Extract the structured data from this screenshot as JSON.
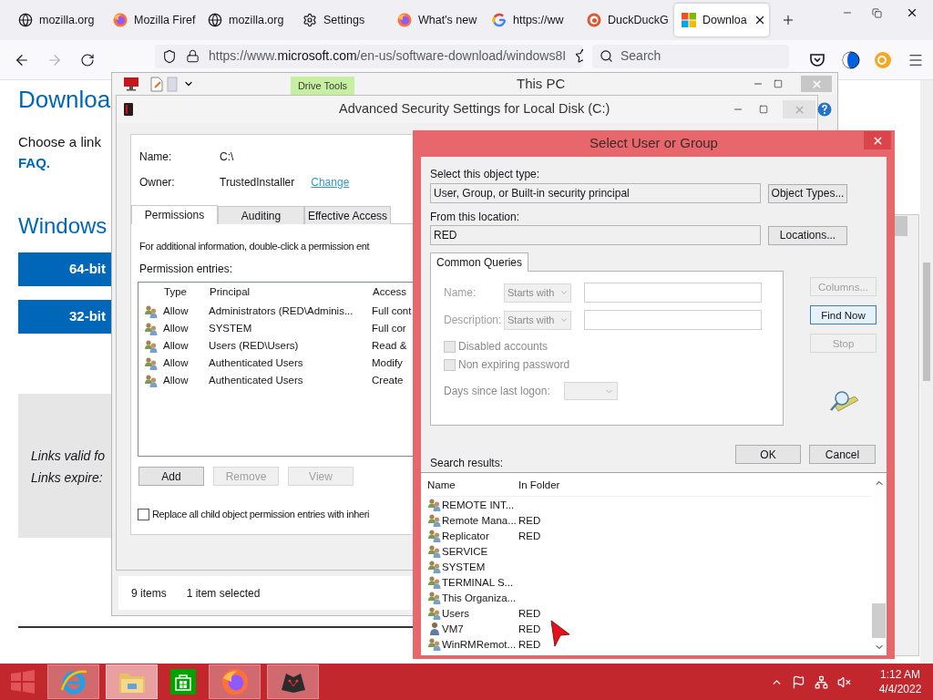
{
  "browser": {
    "tabs": [
      {
        "label": "mozilla.org",
        "kind": "globe",
        "selected": false
      },
      {
        "label": "Mozilla Firef",
        "kind": "firefox",
        "selected": false
      },
      {
        "label": "mozilla.org",
        "kind": "globe",
        "selected": false
      },
      {
        "label": "Settings",
        "kind": "gear",
        "selected": false
      },
      {
        "label": "What's new",
        "kind": "firefox",
        "selected": false
      },
      {
        "label": "https://ww",
        "kind": "google",
        "selected": false
      },
      {
        "label": "DuckDuckG",
        "kind": "duck",
        "selected": false
      },
      {
        "label": "Downloa",
        "kind": "windows",
        "selected": true
      }
    ],
    "url": {
      "prefix": "https://www.",
      "domain": "microsoft.com",
      "path": "/en-us/software-download/windows8I"
    },
    "search_placeholder": "Search",
    "page": {
      "heading": "Downloa",
      "intro": "Choose a link",
      "faq": "FAQ.",
      "subheading": "Windows",
      "downloads": [
        "64-bit",
        "32-bit"
      ],
      "notes": [
        "Links valid fo",
        "Links expire:"
      ]
    }
  },
  "explorer": {
    "title": "This PC",
    "ribbon_tab": "Drive Tools",
    "status": [
      "9 items",
      "1 item selected"
    ]
  },
  "security_dialog": {
    "title": "Advanced Security Settings for Local Disk (C:)",
    "name_label": "Name:",
    "name": "C:\\",
    "owner_label": "Owner:",
    "owner": "TrustedInstaller",
    "change_link": "Change",
    "tabs": [
      {
        "label": "Permissions",
        "selected": true
      },
      {
        "label": "Auditing",
        "selected": false
      },
      {
        "label": "Effective Access",
        "selected": false
      }
    ],
    "info": "For additional information, double-click a permission ent",
    "entries_label": "Permission entries:",
    "columns": [
      "Type",
      "Principal",
      "Access"
    ],
    "entries": [
      {
        "type": "Allow",
        "principal": "Administrators (RED\\Adminis...",
        "access": "Full cont"
      },
      {
        "type": "Allow",
        "principal": "SYSTEM",
        "access": "Full cor"
      },
      {
        "type": "Allow",
        "principal": "Users (RED\\Users)",
        "access": "Read &"
      },
      {
        "type": "Allow",
        "principal": "Authenticated Users",
        "access": "Modify"
      },
      {
        "type": "Allow",
        "principal": "Authenticated Users",
        "access": "Create"
      }
    ],
    "buttons": [
      {
        "label": "Add",
        "disabled": false
      },
      {
        "label": "Remove",
        "disabled": true
      },
      {
        "label": "View",
        "disabled": true
      }
    ],
    "replace_checkbox": {
      "label": "Replace all child object permission entries with inheri",
      "checked": false
    }
  },
  "select_dialog": {
    "title": "Select User or Group",
    "object_type_label": "Select this object type:",
    "object_type": "User, Group, or Built-in security principal",
    "object_types_button": "Object Types...",
    "location_label": "From this location:",
    "location": "RED",
    "locations_button": "Locations...",
    "query_tab": {
      "label": "Common Queries",
      "selected": true
    },
    "queries": [
      {
        "label": "Name:",
        "mode": "Starts with",
        "disabled": true
      },
      {
        "label": "Description:",
        "mode": "Starts with",
        "disabled": true
      }
    ],
    "checkboxes": [
      {
        "label": "Disabled accounts",
        "checked": false,
        "disabled": true
      },
      {
        "label": "Non expiring password",
        "checked": false,
        "disabled": true
      }
    ],
    "days_label": "Days since last logon:",
    "side_buttons": [
      {
        "label": "Columns...",
        "disabled": true,
        "focused": false
      },
      {
        "label": "Find Now",
        "disabled": false,
        "focused": true
      },
      {
        "label": "Stop",
        "disabled": true,
        "focused": false
      }
    ],
    "ok": "OK",
    "cancel": "Cancel",
    "results_label": "Search results:",
    "result_columns": [
      "Name",
      "In Folder"
    ],
    "results": [
      {
        "name": "REMOTE INT...",
        "kind": "group"
      },
      {
        "name": "Remote Mana...",
        "folder": "RED",
        "kind": "group"
      },
      {
        "name": "Replicator",
        "folder": "RED",
        "kind": "group"
      },
      {
        "name": "SERVICE",
        "kind": "group"
      },
      {
        "name": "SYSTEM",
        "kind": "group"
      },
      {
        "name": "TERMINAL S...",
        "kind": "group"
      },
      {
        "name": "This Organiza...",
        "kind": "group"
      },
      {
        "name": "Users",
        "folder": "RED",
        "kind": "group"
      },
      {
        "name": "VM7",
        "folder": "RED",
        "kind": "user"
      },
      {
        "name": "WinRMRemot...",
        "folder": "RED",
        "kind": "group"
      }
    ]
  },
  "taskbar": {
    "apps": [
      {
        "kind": "ie",
        "open": true,
        "selected": false
      },
      {
        "kind": "explorer",
        "open": true,
        "selected": true
      },
      {
        "kind": "store",
        "open": false,
        "selected": false
      },
      {
        "kind": "firefox",
        "open": true,
        "selected": false
      },
      {
        "kind": "app",
        "open": true,
        "selected": false
      }
    ],
    "time": "1:12 AM",
    "date": "4/4/2022"
  }
}
